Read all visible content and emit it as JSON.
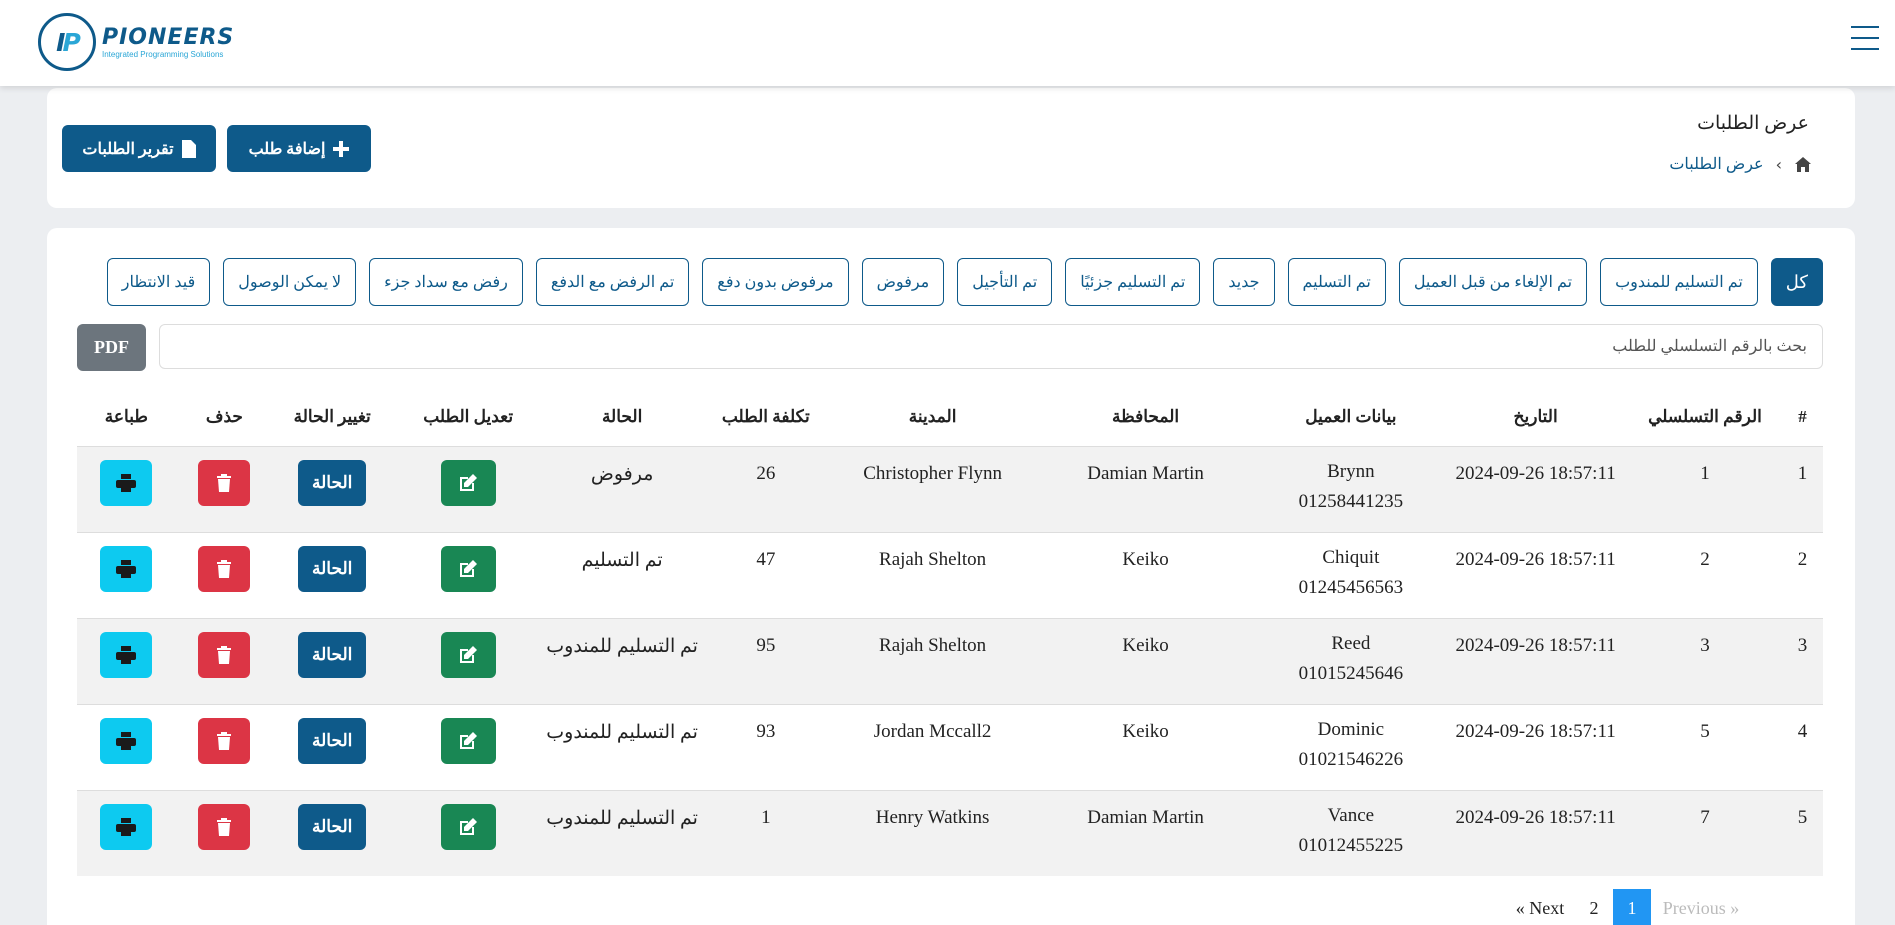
{
  "brand": {
    "name": "PIONEERS",
    "tagline": "Integrated Programming Solutions",
    "monogram": "IP",
    "color": "#0e5a8a"
  },
  "header": {
    "title": "عرض الطلبات",
    "breadcrumb": {
      "home_icon": "home-icon",
      "current": "عرض الطلبات"
    },
    "add_button": "إضافة طلب",
    "report_button": "تقرير الطلبات"
  },
  "filters": [
    "كل",
    "تم التسليم للمندوب",
    "تم الإلغاء من قبل العميل",
    "تم التسليم",
    "جديد",
    "تم التسليم جزئيًا",
    "تم التأجيل",
    "مرفوض",
    "مرفوض بدون دفع",
    "تم الرفض مع الدفع",
    "رفض مع سداد جزء",
    "لا يمكن الوصول",
    "قيد الانتظار"
  ],
  "search": {
    "placeholder": "بحث بالرقم التسلسلي للطلب"
  },
  "pdf_label": "PDF",
  "table": {
    "headers": [
      "#",
      "الرقم التسلسلي",
      "التاريخ",
      "بيانات العميل",
      "المحافظة",
      "المدينة",
      "تكلفة الطلب",
      "الحالة",
      "تعديل الطلب",
      "تغيير الحالة",
      "حذف",
      "طباعة"
    ],
    "status_button": "الحالة",
    "rows": [
      {
        "idx": "1",
        "serial": "1",
        "date": "2024-09-26 18:57:11",
        "customer": "Brynn",
        "phone": "01258441235",
        "governorate": "Damian Martin",
        "city": "Christopher Flynn",
        "cost": "26",
        "status": "مرفوض"
      },
      {
        "idx": "2",
        "serial": "2",
        "date": "2024-09-26 18:57:11",
        "customer": "Chiquit",
        "phone": "01245456563",
        "governorate": "Keiko",
        "city": "Rajah Shelton",
        "cost": "47",
        "status": "تم التسليم"
      },
      {
        "idx": "3",
        "serial": "3",
        "date": "2024-09-26 18:57:11",
        "customer": "Reed",
        "phone": "01015245646",
        "governorate": "Keiko",
        "city": "Rajah Shelton",
        "cost": "95",
        "status": "تم التسليم للمندوب"
      },
      {
        "idx": "4",
        "serial": "5",
        "date": "2024-09-26 18:57:11",
        "customer": "Dominic",
        "phone": "01021546226",
        "governorate": "Keiko",
        "city": "Jordan Mccall2",
        "cost": "93",
        "status": "تم التسليم للمندوب"
      },
      {
        "idx": "5",
        "serial": "7",
        "date": "2024-09-26 18:57:11",
        "customer": "Vance",
        "phone": "01012455225",
        "governorate": "Damian Martin",
        "city": "Henry Watkins",
        "cost": "1",
        "status": "تم التسليم للمندوب"
      }
    ]
  },
  "pagination": {
    "next": "« Next",
    "pages": [
      "2",
      "1"
    ],
    "current": "1",
    "previous": "Previous »"
  }
}
